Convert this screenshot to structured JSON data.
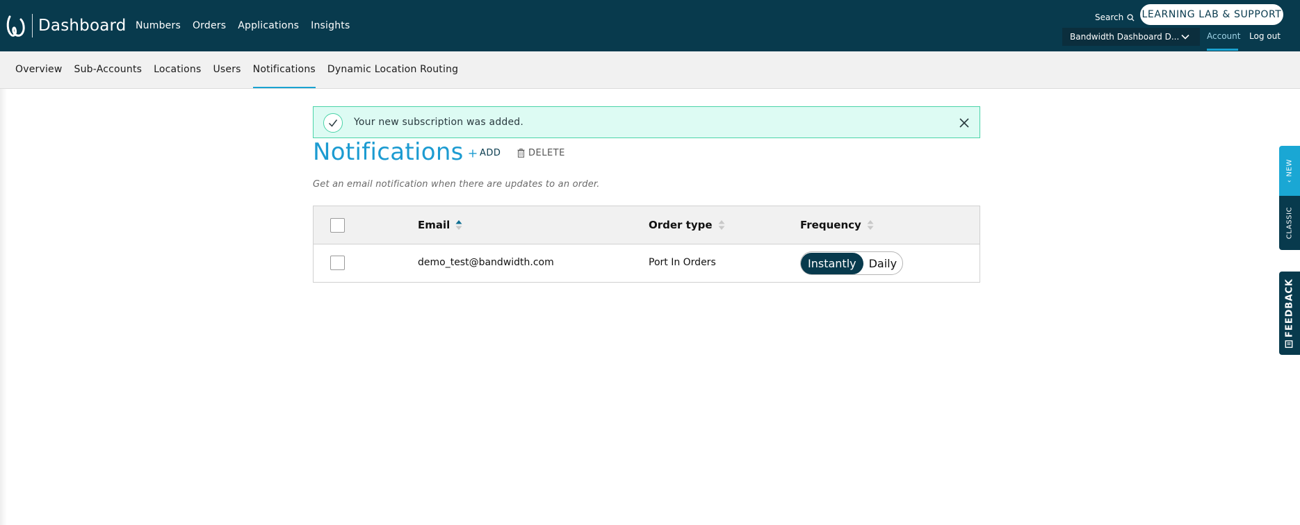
{
  "header": {
    "brand": "Dashboard",
    "nav": [
      "Numbers",
      "Orders",
      "Applications",
      "Insights"
    ],
    "search_label": "Search",
    "support_button": "LEARNING LAB & SUPPORT",
    "account_selector": "Bandwidth Dashboard D...",
    "account_link": "Account",
    "logout_link": "Log out"
  },
  "subnav": {
    "items": [
      "Overview",
      "Sub-Accounts",
      "Locations",
      "Users",
      "Notifications",
      "Dynamic Location Routing"
    ],
    "active": "Notifications"
  },
  "alert": {
    "message": "Your new subscription was added."
  },
  "page": {
    "title": "Notifications",
    "add_label": "ADD",
    "delete_label": "DELETE",
    "subtitle": "Get an email notification when there are updates to an order."
  },
  "table": {
    "columns": [
      "Email",
      "Order type",
      "Frequency"
    ],
    "sorted_column": "Email",
    "rows": [
      {
        "email": "demo_test@bandwidth.com",
        "order_type": "Port In Orders",
        "frequency_options": [
          "Instantly",
          "Daily"
        ],
        "frequency_selected": "Instantly"
      }
    ]
  },
  "side_tabs": {
    "new": "NEW",
    "classic": "CLASSIC",
    "feedback": "FEEDBACK"
  },
  "colors": {
    "header_bg": "#083a4d",
    "accent": "#1c9bd1",
    "alert_bg": "#ddfbf3",
    "alert_border": "#4ad3a8"
  },
  "icons": {
    "logo": "bandwidth-logo",
    "search": "search-icon",
    "chevron": "chevron-down-icon",
    "check": "check-icon",
    "close": "close-icon",
    "add": "plus-icon",
    "delete": "trash-icon",
    "sort": "sort-icon",
    "feedback": "feedback-icon"
  }
}
